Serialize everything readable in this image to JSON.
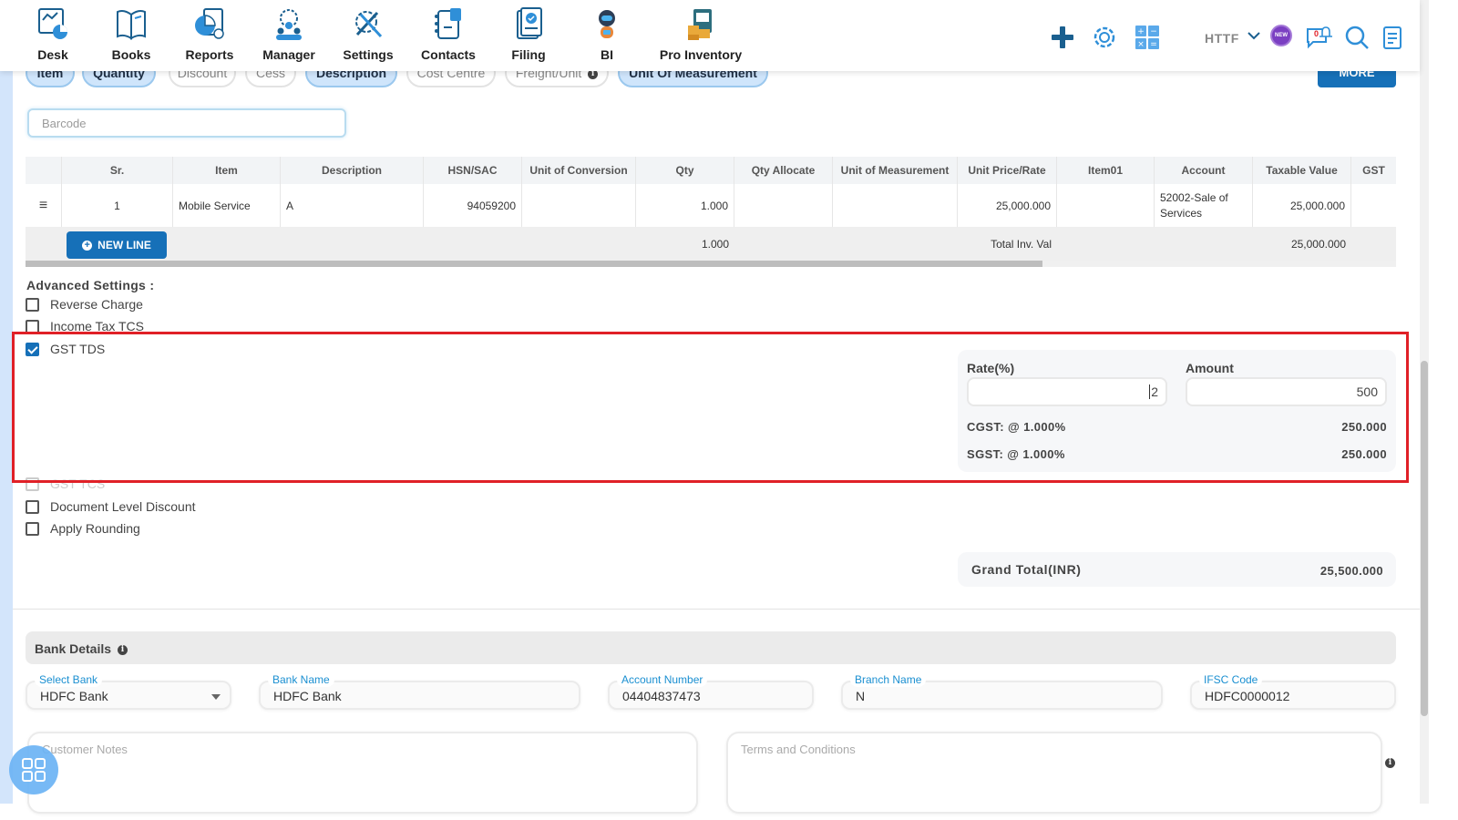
{
  "nav": {
    "items": [
      {
        "label": "Desk",
        "icon": "desk-dashboard-icon"
      },
      {
        "label": "Books",
        "icon": "books-icon"
      },
      {
        "label": "Reports",
        "icon": "reports-icon"
      },
      {
        "label": "Manager",
        "icon": "manager-icon"
      },
      {
        "label": "Settings",
        "icon": "settings-tools-icon"
      },
      {
        "label": "Contacts",
        "icon": "contacts-icon"
      },
      {
        "label": "Filing",
        "icon": "filing-icon"
      },
      {
        "label": "BI",
        "icon": "bi-robot-icon"
      },
      {
        "label": "Pro Inventory",
        "icon": "pro-inventory-icon"
      }
    ],
    "user": "HTTF",
    "new_badge": "NEW",
    "notification_count": "0",
    "colors": {
      "primary": "#1670b8",
      "accent_purple": "#7b3fc2",
      "nav_icon": "#1a5f8f"
    }
  },
  "column_pills": [
    {
      "label": "Item",
      "active": true
    },
    {
      "label": "Quantity",
      "active": true
    },
    {
      "label": "Discount",
      "active": false
    },
    {
      "label": "Cess",
      "active": false
    },
    {
      "label": "Description",
      "active": true
    },
    {
      "label": "Cost Centre",
      "active": false
    },
    {
      "label": "Freight/Unit",
      "active": false
    },
    {
      "label": "Unit Of Measurement",
      "active": true
    }
  ],
  "more_label": "MORE",
  "barcode_placeholder": "Barcode",
  "table": {
    "headers": [
      "",
      "Sr.",
      "Item",
      "Description",
      "HSN/SAC",
      "Unit of Conversion",
      "Qty",
      "Qty Allocate",
      "Unit of Measurement",
      "Unit Price/Rate",
      "Item01",
      "Account",
      "Taxable Value",
      "GST"
    ],
    "rows": [
      {
        "sr": "1",
        "item": "Mobile Service",
        "description": "A",
        "hsn": "94059200",
        "unit_conversion": "",
        "qty": "1.000",
        "qty_allocate": "",
        "uom": "",
        "unit_price": "25,000.000",
        "item01": "",
        "account": "52002-Sale of Services",
        "taxable_value": "25,000.000",
        "gst": ""
      }
    ],
    "footer": {
      "new_line_label": "NEW LINE",
      "qty_total": "1.000",
      "total_label": "Total Inv. Val",
      "taxable_total": "25,000.000"
    }
  },
  "advanced": {
    "title": "Advanced Settings :",
    "options": [
      {
        "label": "Reverse Charge",
        "checked": false
      },
      {
        "label": "Income Tax TCS",
        "checked": false
      },
      {
        "label": "GST TDS",
        "checked": true
      },
      {
        "label": "GST TCS",
        "checked": false
      },
      {
        "label": "Document Level Discount",
        "checked": false
      },
      {
        "label": "Apply Rounding",
        "checked": false
      }
    ]
  },
  "gst_tds": {
    "rate_label": "Rate(%)",
    "rate_value": "2",
    "amount_label": "Amount",
    "amount_value": "500",
    "cgst_label": "CGST: @ 1.000%",
    "cgst_value": "250.000",
    "sgst_label": "SGST: @ 1.000%",
    "sgst_value": "250.000"
  },
  "grand_total": {
    "label": "Grand Total(INR)",
    "value": "25,500.000"
  },
  "bank": {
    "title": "Bank Details",
    "select_bank_label": "Select Bank",
    "select_bank_value": "HDFC Bank",
    "bank_name_label": "Bank Name",
    "bank_name_value": "HDFC Bank",
    "account_number_label": "Account Number",
    "account_number_value": "04404837473",
    "branch_name_label": "Branch Name",
    "branch_name_value": "N",
    "ifsc_label": "IFSC Code",
    "ifsc_value": "HDFC0000012"
  },
  "notes": {
    "customer_placeholder": "Customer Notes",
    "terms_placeholder": "Terms and Conditions"
  },
  "highlight_color": "#e02027"
}
